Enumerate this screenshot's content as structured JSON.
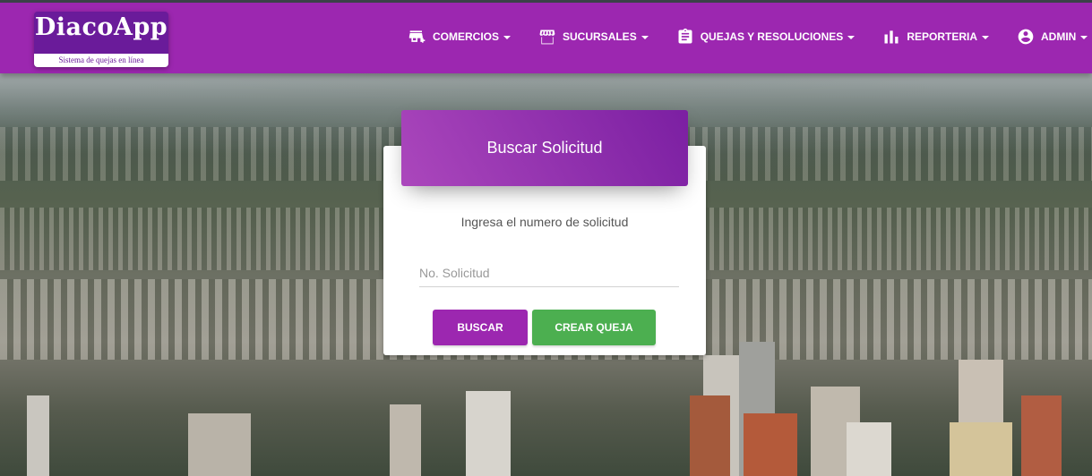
{
  "brand": {
    "title": "DiacoApp",
    "subtitle": "Sistema de quejas en línea"
  },
  "nav": [
    {
      "label": "COMERCIOS",
      "icon": "store-add-icon"
    },
    {
      "label": "SUCURSALES",
      "icon": "storefront-icon"
    },
    {
      "label": "QUEJAS Y RESOLUCIONES",
      "icon": "clipboard-icon"
    },
    {
      "label": "REPORTERIA",
      "icon": "bar-chart-icon"
    },
    {
      "label": "ADMIN",
      "icon": "account-circle-icon"
    }
  ],
  "card": {
    "title": "Buscar Solicitud",
    "description": "Ingresa el numero de solicitud",
    "input_placeholder": "No. Solicitud",
    "input_value": "",
    "search_button": "BUSCAR",
    "create_button": "CREAR QUEJA"
  },
  "colors": {
    "primary": "#9c27b0",
    "success": "#4caf50",
    "navbar": "#9c27b0"
  }
}
